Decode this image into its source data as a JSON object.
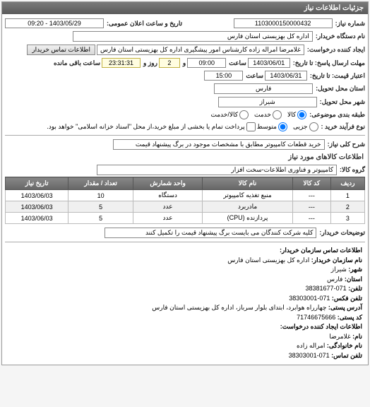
{
  "panel": {
    "title": "جزئیات اطلاعات نیاز"
  },
  "top": {
    "reqNoLabel": "شماره نیاز:",
    "reqNo": "1103000150000432",
    "announceLabel": "تاریخ و ساعت اعلان عمومی:",
    "announceVal": "1403/05/29 - 09:20",
    "orgLabel": "نام دستگاه خریدار:",
    "orgVal": "اداره کل بهزیستی استان فارس",
    "creatorLabel": "ایجاد کننده درخواست:",
    "creatorVal": "غلامرضا امراله زاده کارشناس امور پیشگیری اداره کل بهزیستی استان فارس",
    "contactBtn": "اطلاعات تماس خریدار",
    "deadlineSendLabel": "مهلت ارسال پاسخ: تا تاریخ:",
    "deadlineSendDate": "1403/06/01",
    "atTime": "ساعت",
    "deadlineSendTime": "09:00",
    "remainLabel": "و",
    "remainDays": "2",
    "remainDaysLabel": "روز و",
    "remainTime": "23:31:31",
    "remainSuffix": "ساعت باقی مانده",
    "validityLabel": "اعتبار قیمت: تا تاریخ:",
    "validityDate": "1403/06/31",
    "validityTime": "15:00",
    "deliveryProvLabel": "استان محل تحویل:",
    "deliveryProv": "فارس",
    "deliveryCityLabel": "شهر محل تحویل:",
    "deliveryCity": "شیراز",
    "classLabel": "طبقه بندی موضوعی:",
    "class": {
      "opt1": "کالا",
      "opt2": "خدمت",
      "opt3": "کالا/خدمت"
    },
    "procLabel": "نوع فرآیند خرید :",
    "proc": {
      "opt1": "جزیی",
      "opt2": "متوسط"
    },
    "procNote": "پرداخت تمام یا بخشی از مبلغ خرید،از محل \"اسناد خزانه اسلامی\" خواهد بود."
  },
  "desc": {
    "titleLabel": "شرح کلی نیاز:",
    "titleVal": "خرید قطعات کامپیوتر مطابق با مشخصات موجود در برگ پیشنهاد قیمت",
    "itemsHeader": "اطلاعات کالاهای مورد نیاز",
    "groupLabel": "گروه کالا:",
    "groupVal": "کامپیوتر و فناوری اطلاعات-سخت افزار"
  },
  "table": {
    "headers": [
      "ردیف",
      "کد کالا",
      "نام کالا",
      "واحد شمارش",
      "تعداد / مقدار",
      "تاریخ نیاز"
    ],
    "rows": [
      {
        "idx": "1",
        "code": "---",
        "name": "منبع تغذیه کامپیوتر",
        "unit": "دستگاه",
        "qty": "10",
        "date": "1403/06/03"
      },
      {
        "idx": "2",
        "code": "---",
        "name": "مادربرد",
        "unit": "عدد",
        "qty": "5",
        "date": "1403/06/03"
      },
      {
        "idx": "3",
        "code": "---",
        "name": "پردازنده (CPU)",
        "unit": "عدد",
        "qty": "5",
        "date": "1403/06/03"
      }
    ]
  },
  "buyerNote": {
    "label": "توضیحات خریدار:",
    "val": "کلیه شرکت کنندگان می بایست برگ پیشنهاد قیمت را تکمیل کنند"
  },
  "contact": {
    "header": "اطلاعات تماس سازمان خریدار:",
    "orgLbl": "نام سازمان خریدار:",
    "org": "اداره کل بهزیستی استان فارس",
    "cityLbl": "شهر:",
    "city": "شیراز",
    "provLbl": "استان:",
    "prov": "فارس",
    "telLbl": "تلفن:",
    "tel": "071-38381677",
    "faxLbl": "تلفن فکس:",
    "fax": "071-38303001",
    "addrLbl": "آدرس پستی:",
    "addr": "چهارراه هوابرد، ابتدای بلوار سرباز، اداره کل بهزیستی استان فارس",
    "postLbl": "کد پستی:",
    "post": "71746675666",
    "creatorHdr": "اطلاعات ایجاد کننده درخواست:",
    "nameLbl": "نام:",
    "name": "غلامرضا",
    "famLbl": "نام خانوادگی:",
    "fam": "امراله زاده",
    "ctelLbl": "تلفن تماس:",
    "ctel": "071-38303001"
  }
}
